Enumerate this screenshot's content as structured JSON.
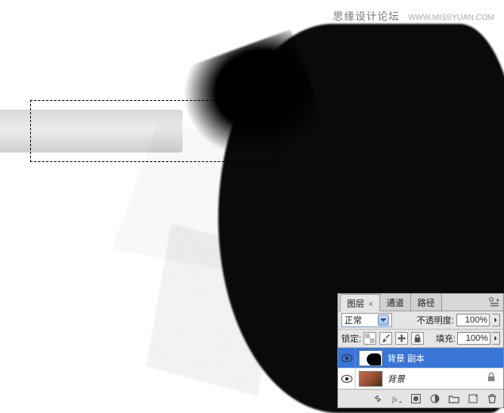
{
  "watermark": {
    "text": "思缘设计论坛",
    "url": "WWW.MISSYUAN.COM"
  },
  "panel": {
    "tabs": {
      "layers": "图层",
      "channels": "通道",
      "paths": "路径"
    },
    "blend": {
      "value": "正常",
      "opacity_label": "不透明度:",
      "opacity_value": "100%"
    },
    "lock": {
      "label": "锁定:",
      "fill_label": "填充:",
      "fill_value": "100%"
    },
    "layers": [
      {
        "name": "背景 副本",
        "selected": true,
        "thumb": "dog"
      },
      {
        "name": "背景",
        "selected": false,
        "thumb": "bg",
        "locked": true,
        "italic": true
      }
    ]
  }
}
